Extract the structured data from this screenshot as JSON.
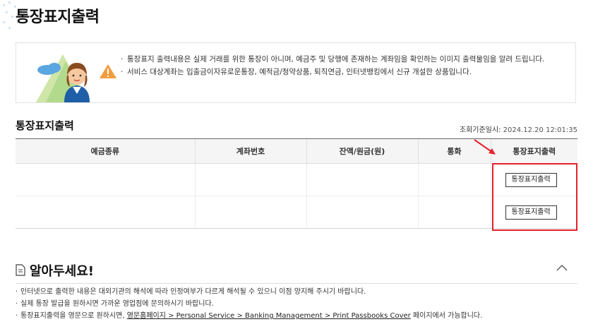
{
  "page": {
    "title": "통장표지출력"
  },
  "notice": {
    "items": [
      "통장표지 출력내용은 실제 거래를 위한 통장이 아니며, 예금주 및 당행에 존재하는 계좌임을 확인하는 이미지 출력물임을 알려 드립니다.",
      "서비스 대상계좌는 입출금이자유로운통장, 예적금/청약상품, 퇴직연금, 인터넷뱅킹에서 신규 개설한 상품입니다."
    ]
  },
  "section": {
    "title": "통장표지출력",
    "query_label": "조회기준일시:",
    "query_time": "2024.12.20 12:01:35"
  },
  "table": {
    "headers": [
      "예금종류",
      "계좌번호",
      "잔액/원금(원)",
      "통화",
      "통장표지출력"
    ],
    "rows": [
      {
        "deposit_type": "",
        "account_number": "",
        "balance": "",
        "currency": "",
        "button_label": "통장표지출력"
      },
      {
        "deposit_type": "",
        "account_number": "",
        "balance": "",
        "currency": "",
        "button_label": "통장표지출력"
      }
    ]
  },
  "known": {
    "title": "알아두세요!",
    "items": [
      "인터넷으로 출력한 내용은 대외기관의 해석에 따라 인정여부가 다르게 해석될 수 있으니 이점 양지해 주시기 바랍니다.",
      "실제 통장 발급을 원하시면 가까운 영업점에 문의하시기 바랍니다."
    ],
    "item3_prefix": "통장표지출력을 영문으로 원하시면, ",
    "item3_link": "영문홈페이지 > Personal Service > Banking Management > Print Passbooks Cover",
    "item3_suffix": " 페이지에서 가능합니다."
  },
  "colors": {
    "highlight": "#e5212b",
    "accent_blue": "#1e5fa8",
    "header_bg": "#f5f5f5"
  },
  "icons": {
    "notice_illustration": "bank-clerk-illustration",
    "known_icon": "document-icon",
    "collapse": "chevron-up-icon",
    "annotation": "red-arrow-icon"
  }
}
